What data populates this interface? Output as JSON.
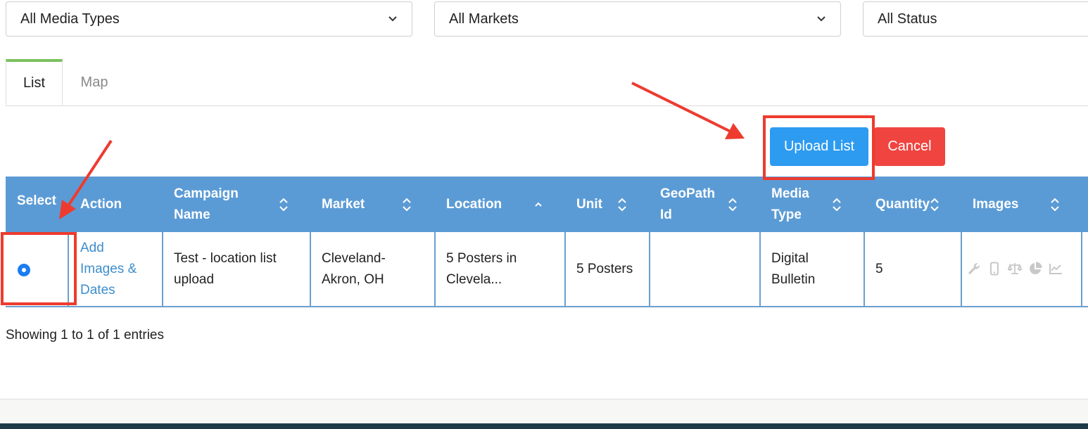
{
  "filters": [
    {
      "value": "All Media Types"
    },
    {
      "value": "All Markets"
    },
    {
      "value": "All Status"
    }
  ],
  "tabs": [
    {
      "label": "List",
      "active": true
    },
    {
      "label": "Map",
      "active": false
    }
  ],
  "buttons": {
    "upload": "Upload List",
    "cancel": "Cancel"
  },
  "table": {
    "headers": [
      "Select",
      "Action",
      "Campaign Name",
      "Market",
      "Location",
      "Unit",
      "GeoPath Id",
      "Media Type",
      "Quantity",
      "Images"
    ],
    "row": {
      "selected": true,
      "action": "Add Images & Dates",
      "campaign_name": "Test - location list upload",
      "market": "Cleveland-Akron, OH",
      "location": "5 Posters in Clevela...",
      "unit": "5 Posters",
      "geopath_id": "",
      "media_type": "Digital Bulletin",
      "quantity": "5",
      "images_icons": [
        "wrench-icon",
        "mobile-icon",
        "balance-scale-icon",
        "pie-chart-icon",
        "line-chart-icon"
      ]
    }
  },
  "status": {
    "showing": "Showing 1 to 1 of 1 entries"
  },
  "colors": {
    "header_bg": "#5b9bd5",
    "upload_btn": "#2d9bf0",
    "cancel_btn": "#f04440",
    "active_tab_accent": "#7cc15f",
    "annotation": "#ee3b2f",
    "link": "#3d8dcc"
  }
}
